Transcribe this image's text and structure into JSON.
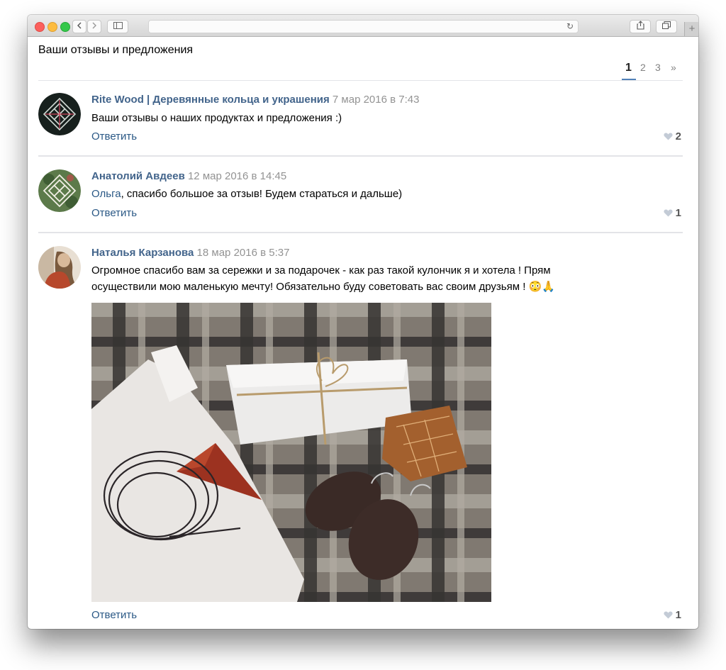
{
  "browser": {
    "back_icon": "chevron-left-icon",
    "forward_icon": "chevron-right-icon",
    "sidebar_icon": "sidebar-icon",
    "reload_icon": "reload-icon",
    "share_icon": "share-icon",
    "tabs_icon": "tabs-icon",
    "new_tab_icon": "plus-icon"
  },
  "page": {
    "heading": "Ваши отзывы и предложения",
    "pagination": {
      "pages": [
        "1",
        "2",
        "3"
      ],
      "active": "1",
      "next": "»"
    }
  },
  "comments": [
    {
      "author": "Rite Wood | Деревянные кольца и украшения",
      "date": "7 мар 2016 в 7:43",
      "text": "Ваши отзывы о наших продуктах и предложения :)",
      "reply_label": "Ответить",
      "likes": "2"
    },
    {
      "author": "Анатолий Авдеев",
      "date": "12 мар 2016 в 14:45",
      "mention": "Ольга",
      "text": ", спасибо большое за отзыв! Будем стараться и дальше)",
      "reply_label": "Ответить",
      "likes": "1"
    },
    {
      "author": "Наталья Карзанова",
      "date": "18 мар 2016 в 5:37",
      "text_line1": "Огромное спасибо вам за сережки и за подарочек - как раз такой кулончик я и хотела ! Прям",
      "text_line2": "осуществили мою маленькую мечту! Обязательно буду советовать вас своим друзьям ! 😳🙏",
      "reply_label": "Ответить",
      "likes": "1"
    }
  ],
  "colors": {
    "link": "#2a5885",
    "author": "#42648b",
    "date": "#939393",
    "separator": "#e3e4e8"
  }
}
